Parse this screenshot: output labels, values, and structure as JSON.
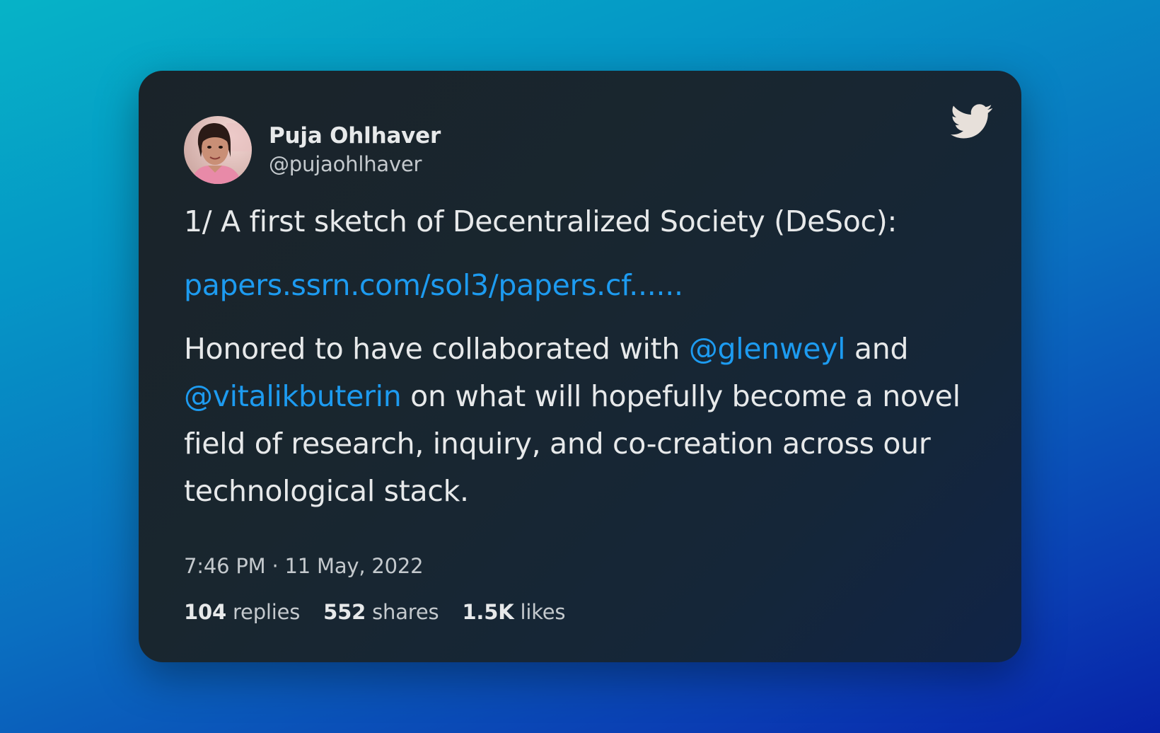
{
  "author": {
    "display_name": "Puja Ohlhaver",
    "handle": "@pujaohlhaver"
  },
  "tweet": {
    "line1": "1/ A first sketch of Decentralized Society (DeSoc):",
    "link": "papers.ssrn.com/sol3/papers.cf......",
    "para3_part1": "Honored to have collaborated with ",
    "mention1": "@glenweyl",
    "para3_part2": " and ",
    "mention2": "@vitalikbuterin",
    "para3_part3": " on what will hopefully become a novel field of research, inquiry, and co-creation across our technological stack."
  },
  "timestamp": "7:46 PM · 11 May, 2022",
  "stats": {
    "replies_count": "104",
    "replies_label": "replies",
    "shares_count": "552",
    "shares_label": "shares",
    "likes_count": "1.5K",
    "likes_label": "likes"
  },
  "icons": {
    "brand": "twitter-bird-icon"
  },
  "colors": {
    "link": "#1d9bf0",
    "text": "#e7e9ea",
    "muted": "#c4c9cd",
    "card_bg": "#1a2329"
  }
}
